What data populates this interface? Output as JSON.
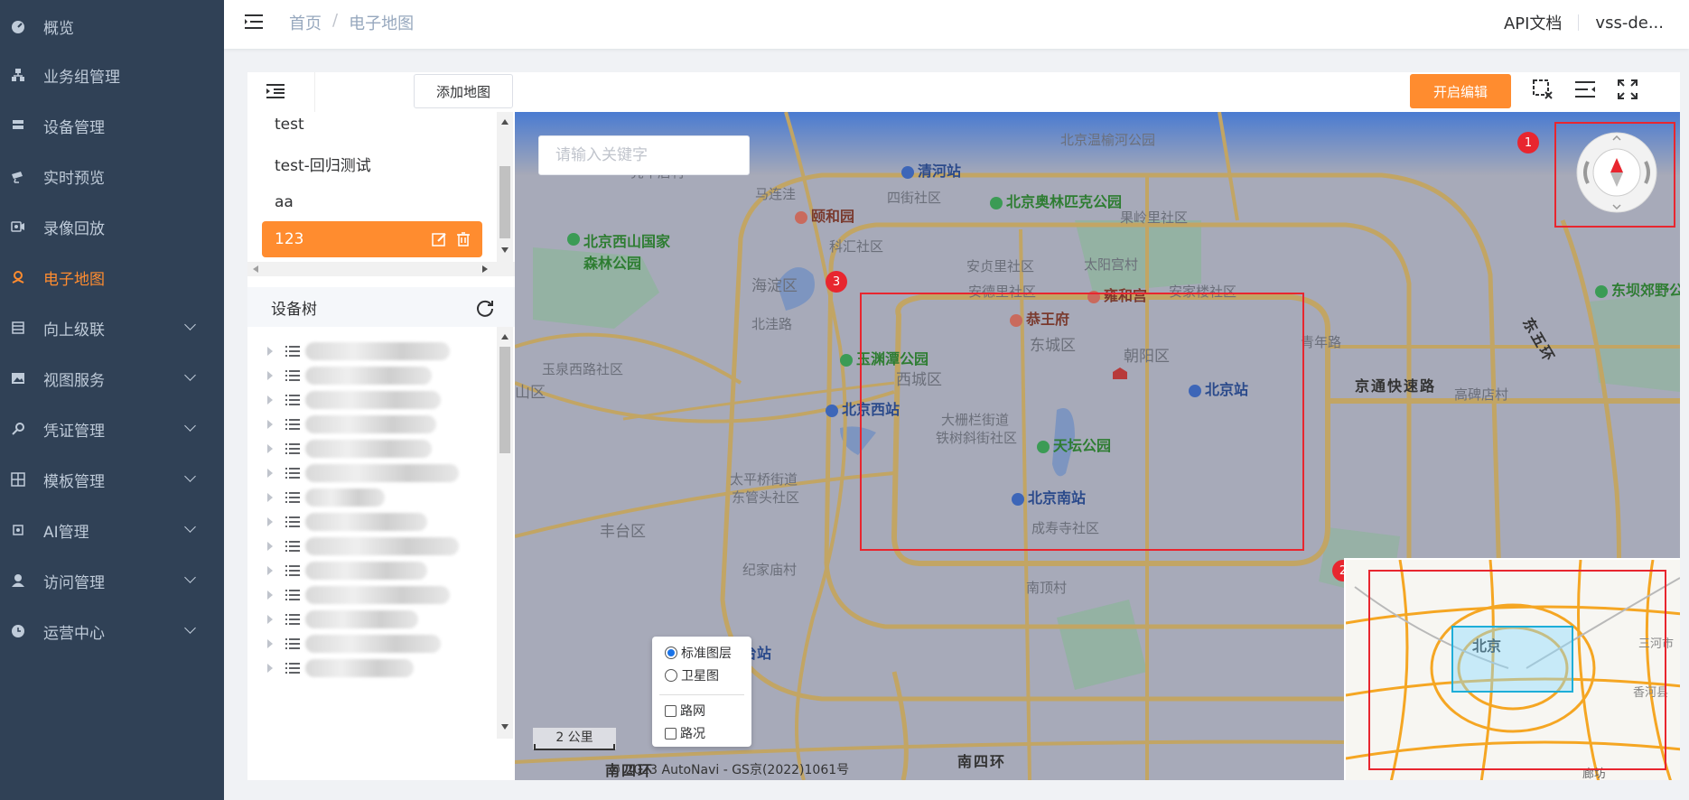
{
  "sidebar": {
    "items": [
      {
        "label": "概览",
        "icon": "dashboard-icon"
      },
      {
        "label": "业务组管理",
        "icon": "org-icon"
      },
      {
        "label": "设备管理",
        "icon": "device-icon"
      },
      {
        "label": "实时预览",
        "icon": "camera-icon"
      },
      {
        "label": "录像回放",
        "icon": "playback-icon"
      },
      {
        "label": "电子地图",
        "icon": "map-pin-icon",
        "active": true
      },
      {
        "label": "向上级联",
        "icon": "cascade-icon",
        "expandable": true
      },
      {
        "label": "视图服务",
        "icon": "image-icon",
        "expandable": true
      },
      {
        "label": "凭证管理",
        "icon": "key-icon",
        "expandable": true
      },
      {
        "label": "模板管理",
        "icon": "grid-icon",
        "expandable": true
      },
      {
        "label": "AI管理",
        "icon": "ai-icon",
        "expandable": true
      },
      {
        "label": "访问管理",
        "icon": "user-icon",
        "expandable": true
      },
      {
        "label": "运营中心",
        "icon": "clock-icon",
        "expandable": true
      }
    ],
    "active_color": "#ff8c2f"
  },
  "header": {
    "breadcrumb": [
      "首页",
      "电子地图"
    ],
    "api_docs": "API文档",
    "user": "vss-de..."
  },
  "map_list": {
    "add_button": "添加地图",
    "items": [
      "test",
      "test-回归测试",
      "aa",
      "123"
    ],
    "selected": "123"
  },
  "device_tree": {
    "title": "设备树"
  },
  "toolbar": {
    "edit_button": "开启编辑"
  },
  "map": {
    "search_placeholder": "请输入关键字",
    "layers": {
      "standard": "标准图层",
      "satellite": "卫星图",
      "road_net": "路网",
      "traffic": "路况",
      "selected": "标准图层"
    },
    "scale": "2 公里",
    "copyright": "© 2023 AutoNavi - GS京(2022)1061号",
    "badges": [
      "1",
      "2",
      "3"
    ],
    "overview_city": "北京",
    "overview_labels": [
      "三河市",
      "香河县",
      "廊坊"
    ],
    "labels": {
      "districts": [
        "亮甲店村",
        "马连洼",
        "四街社区",
        "科汇社区",
        "果岭里社区",
        "海淀区",
        "安贞里社区",
        "太阳宫村",
        "安德里社区",
        "北洼路",
        "安家楼社区",
        "东城区",
        "朝阳区",
        "青年路",
        "玉泉西路社区",
        "西城区",
        "山区",
        "高碑店村",
        "大栅栏街道",
        "铁树斜街社区",
        "太平桥街道",
        "东管头社区",
        "丰台区",
        "成寿寺社区",
        "纪家庙村",
        "南顶村",
        "北京温榆河公园"
      ],
      "parks": [
        "北京西山国家森林公园",
        "北京奥林匹克公园",
        "玉渊潭公园",
        "天坛公园",
        "东坝郊野公"
      ],
      "pois": [
        "颐和园",
        "雍和宫",
        "恭王府"
      ],
      "stations": [
        "清河站",
        "北京站",
        "北京西站",
        "北京南站",
        "台站"
      ],
      "roads": [
        "京通快速路",
        "南四环",
        "南四环",
        "东五环"
      ]
    }
  },
  "colors": {
    "sidebar_bg": "#304156",
    "accent": "#ff8c2f",
    "marker_red": "#e8262f"
  }
}
